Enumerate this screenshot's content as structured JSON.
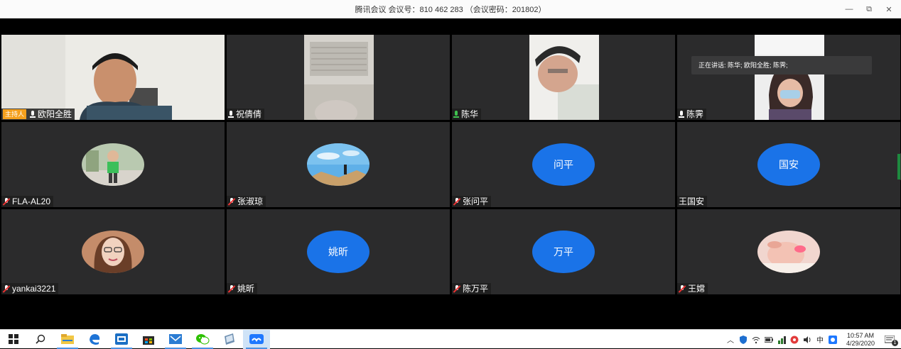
{
  "window": {
    "title": "腾讯会议 会议号：810 462 283 （会议密码：201802）",
    "min_label": "—",
    "max_label": "⧉",
    "close_label": "✕"
  },
  "speaking_tip": "正在讲话: 陈华; 欧阳全胜; 陈霁;",
  "host_badge": "主持人",
  "participants": [
    {
      "name": "欧阳全胜",
      "mic": "active",
      "kind": "video"
    },
    {
      "name": "祝倩倩",
      "mic": "on",
      "kind": "video"
    },
    {
      "name": "陈华",
      "mic": "active",
      "kind": "video"
    },
    {
      "name": "陈霁",
      "mic": "on",
      "kind": "video"
    },
    {
      "name": "FLA-AL20",
      "mic": "muted",
      "kind": "photo"
    },
    {
      "name": "张淑琼",
      "mic": "muted",
      "kind": "photo"
    },
    {
      "name": "张问平",
      "mic": "muted",
      "kind": "initials",
      "initials": "问平"
    },
    {
      "name": "王国安",
      "mic": "none",
      "kind": "initials",
      "initials": "国安"
    },
    {
      "name": "yankai3221",
      "mic": "muted",
      "kind": "photo"
    },
    {
      "name": "姚昕",
      "mic": "muted",
      "kind": "initials",
      "initials": "姚昕"
    },
    {
      "name": "陈万平",
      "mic": "muted",
      "kind": "initials",
      "initials": "万平"
    },
    {
      "name": "王嫦",
      "mic": "muted",
      "kind": "photo"
    }
  ],
  "taskbar": {
    "icons": [
      "windows-start-icon",
      "search-icon",
      "file-explorer-icon",
      "edge-icon",
      "store-app-icon",
      "store-bag-icon",
      "mail-icon",
      "wechat-icon",
      "notes-icon",
      "tencent-meeting-icon"
    ]
  },
  "tray": {
    "ime": "中",
    "time": "10:57 AM",
    "date": "4/29/2020",
    "notification_count": "1"
  },
  "colors": {
    "accent": "#1a73e8",
    "host_badge": "#f5a01d",
    "mic_active": "#3fc24f",
    "tile_bg": "#2b2b2c"
  }
}
